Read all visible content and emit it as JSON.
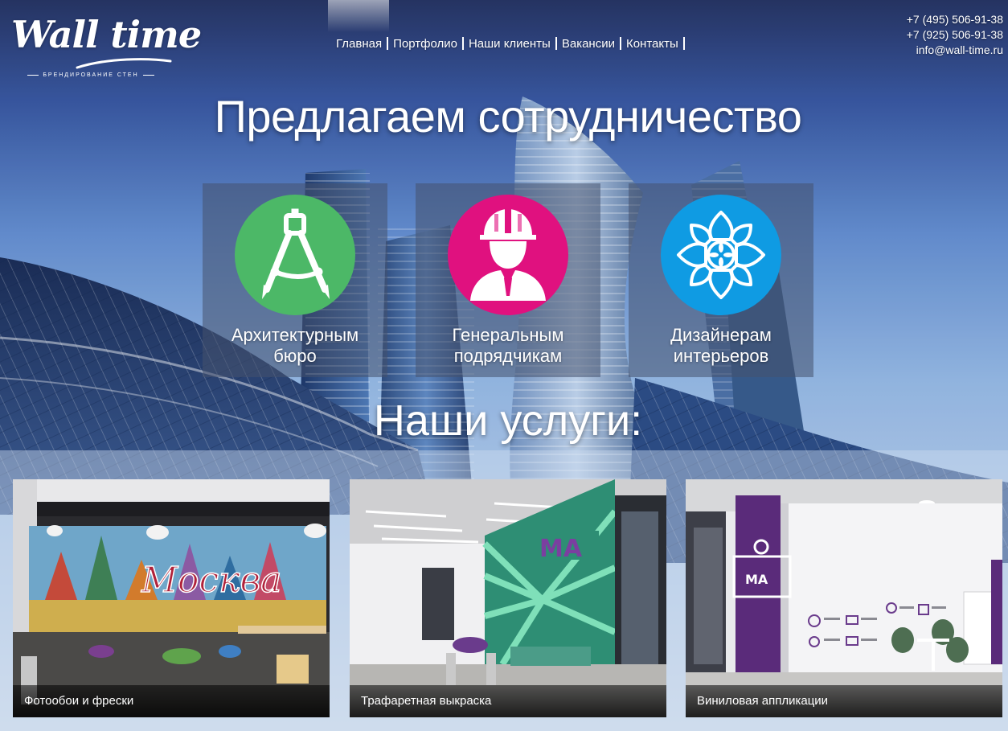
{
  "logo": {
    "main": "Wall time",
    "sub": "БРЕНДИРОВАНИЕ СТЕН"
  },
  "nav": {
    "items": [
      {
        "label": "Главная"
      },
      {
        "label": "Портфолио"
      },
      {
        "label": "Наши клиенты"
      },
      {
        "label": "Вакансии"
      },
      {
        "label": "Контакты"
      }
    ]
  },
  "contacts": {
    "phone1": "+7 (495) 506-91-38",
    "phone2": "+7 (925) 506-91-38",
    "email": "info@wall-time.ru"
  },
  "hero": {
    "title": "Предлагаем сотрудничество"
  },
  "cooperation": [
    {
      "line1": "Архитектурным",
      "line2": "бюро",
      "icon": "drafting-compass-icon",
      "color": "#4cb867"
    },
    {
      "line1": "Генеральным",
      "line2": "подрядчикам",
      "icon": "contractor-helmet-icon",
      "color": "#e0117f"
    },
    {
      "line1": "Дизайнерам",
      "line2": "интерьеров",
      "icon": "ornament-flower-icon",
      "color": "#0f9be3"
    }
  ],
  "services": {
    "title": "Наши услуги:",
    "cards": [
      {
        "caption": "Фотообои и фрески"
      },
      {
        "caption": "Трафаретная выкраска"
      },
      {
        "caption": "Виниловая аппликации"
      }
    ]
  }
}
